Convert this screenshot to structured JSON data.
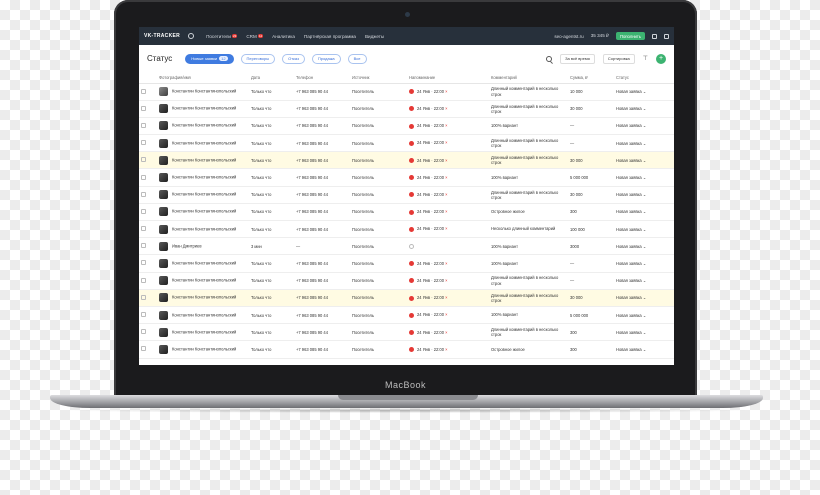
{
  "laptop": {
    "brand": "MacBook"
  },
  "topbar": {
    "logo": "VK-TRACKER",
    "nav": [
      {
        "label": "Посетители",
        "badge": "23"
      },
      {
        "label": "CRM",
        "badge": "12"
      },
      {
        "label": "Аналитика",
        "badge": ""
      },
      {
        "label": "Партнёрская программа",
        "badge": ""
      },
      {
        "label": "Виджеты",
        "badge": ""
      }
    ],
    "site": "seo-agentst.ru",
    "balance": "35 345 ₽",
    "pay_label": "Пополнить"
  },
  "toolbar": {
    "title": "Статус",
    "filters": [
      {
        "label": "Новые заявки",
        "count": "12",
        "active": true
      },
      {
        "label": "Переговоры",
        "count": ""
      },
      {
        "label": "Отказ",
        "count": ""
      },
      {
        "label": "Продажа",
        "count": ""
      },
      {
        "label": "Все",
        "count": ""
      }
    ],
    "period": "За всё время",
    "sort": "Сортировка"
  },
  "table": {
    "headers": [
      "Фотография/имя",
      "Дата",
      "Телефон",
      "Источник",
      "Напоминание",
      "Комментарий",
      "Сумма, ₽",
      "Статус"
    ],
    "rows": [
      {
        "name": "Константин Константинопольский",
        "date": "Только что",
        "phone": "+7 963 085 90 44",
        "source": "Посетитель",
        "reminder": "24 Янв · 22:00",
        "comment": "Длинный комментарий в несколько строк",
        "sum": "10 000",
        "status": "Новая заявка",
        "hl": false,
        "rem": true,
        "ava": false
      },
      {
        "name": "Константин Константинопольский",
        "date": "Только что",
        "phone": "+7 963 085 90 44",
        "source": "Посетитель",
        "reminder": "24 Янв · 22:00",
        "comment": "Длинный комментарий в несколько строк",
        "sum": "30 000",
        "status": "Новая заявка",
        "hl": false,
        "rem": true,
        "ava": true
      },
      {
        "name": "Константин Константинопольский",
        "date": "Только что",
        "phone": "+7 963 085 90 44",
        "source": "Посетитель",
        "reminder": "24 Янв · 22:00",
        "comment": "100% вариант",
        "sum": "—",
        "status": "Новая заявка",
        "hl": false,
        "rem": true,
        "ava": true
      },
      {
        "name": "Константин Константинопольский",
        "date": "Только что",
        "phone": "+7 963 085 90 44",
        "source": "Посетитель",
        "reminder": "24 Янв · 22:00",
        "comment": "Длинный комментарий в несколько строк",
        "sum": "—",
        "status": "Новая заявка",
        "hl": false,
        "rem": true,
        "ava": true
      },
      {
        "name": "Константин Константинопольский",
        "date": "Только что",
        "phone": "+7 963 085 90 44",
        "source": "Посетитель",
        "reminder": "24 Янв · 22:00",
        "comment": "Длинный комментарий в несколько строк",
        "sum": "30 000",
        "status": "Новая заявка",
        "hl": true,
        "rem": true,
        "ava": true
      },
      {
        "name": "Константин Константинопольский",
        "date": "Только что",
        "phone": "+7 963 085 90 44",
        "source": "Посетитель",
        "reminder": "24 Янв · 22:00",
        "comment": "100% вариант",
        "sum": "5 000 000",
        "status": "Новая заявка",
        "hl": false,
        "rem": true,
        "ava": true
      },
      {
        "name": "Константин Константинопольский",
        "date": "Только что",
        "phone": "+7 963 085 90 44",
        "source": "Посетитель",
        "reminder": "24 Янв · 22:00",
        "comment": "Длинный комментарий в несколько строк",
        "sum": "30 000",
        "status": "Новая заявка",
        "hl": false,
        "rem": true,
        "ava": true
      },
      {
        "name": "Константин Константинопольский",
        "date": "Только что",
        "phone": "+7 963 085 90 44",
        "source": "Посетитель",
        "reminder": "24 Янв · 22:00",
        "comment": "Островное жилое",
        "sum": "300",
        "status": "Новая заявка",
        "hl": false,
        "rem": true,
        "ava": true
      },
      {
        "name": "Константин Константинопольский",
        "date": "Только что",
        "phone": "+7 963 085 90 44",
        "source": "Посетитель",
        "reminder": "24 Янв · 22:00",
        "comment": "Несколько длинный комментарий",
        "sum": "100 000",
        "status": "Новая заявка",
        "hl": false,
        "rem": true,
        "ava": true
      },
      {
        "name": "Иван Дмитриев",
        "date": "3 мин",
        "phone": "—",
        "source": "Посетитель",
        "reminder": "",
        "comment": "100% вариант",
        "sum": "3000",
        "status": "Новая заявка",
        "hl": false,
        "rem": false,
        "ava": true
      },
      {
        "name": "Константин Константинопольский",
        "date": "Только что",
        "phone": "+7 963 085 90 44",
        "source": "Посетитель",
        "reminder": "24 Янв · 22:00",
        "comment": "100% вариант",
        "sum": "—",
        "status": "Новая заявка",
        "hl": false,
        "rem": true,
        "ava": true
      },
      {
        "name": "Константин Константинопольский",
        "date": "Только что",
        "phone": "+7 963 085 90 44",
        "source": "Посетитель",
        "reminder": "24 Янв · 22:00",
        "comment": "Длинный комментарий в несколько строк",
        "sum": "—",
        "status": "Новая заявка",
        "hl": false,
        "rem": true,
        "ava": true
      },
      {
        "name": "Константин Константинопольский",
        "date": "Только что",
        "phone": "+7 963 085 90 44",
        "source": "Посетитель",
        "reminder": "24 Янв · 22:00",
        "comment": "Длинный комментарий в несколько строк",
        "sum": "30 000",
        "status": "Новая заявка",
        "hl": true,
        "rem": true,
        "ava": true
      },
      {
        "name": "Константин Константинопольский",
        "date": "Только что",
        "phone": "+7 963 085 90 44",
        "source": "Посетитель",
        "reminder": "24 Янв · 22:00",
        "comment": "100% вариант",
        "sum": "5 000 000",
        "status": "Новая заявка",
        "hl": false,
        "rem": true,
        "ava": true
      },
      {
        "name": "Константин Константинопольский",
        "date": "Только что",
        "phone": "+7 963 085 90 44",
        "source": "Посетитель",
        "reminder": "24 Янв · 22:00",
        "comment": "Длинный комментарий в несколько строк",
        "sum": "300",
        "status": "Новая заявка",
        "hl": false,
        "rem": true,
        "ava": true
      },
      {
        "name": "Константин Константинопольский",
        "date": "Только что",
        "phone": "+7 963 085 90 44",
        "source": "Посетитель",
        "reminder": "24 Янв · 22:00",
        "comment": "Островное жилое",
        "sum": "300",
        "status": "Новая заявка",
        "hl": false,
        "rem": true,
        "ava": true
      }
    ]
  }
}
